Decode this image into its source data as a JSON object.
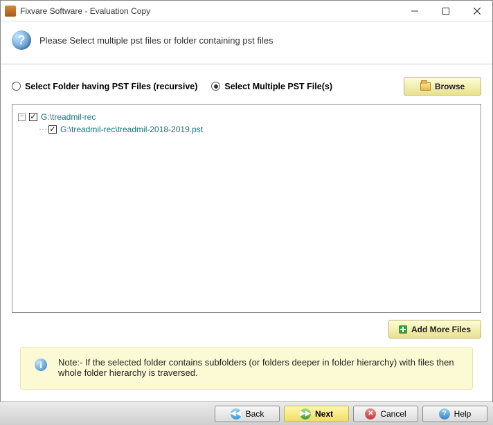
{
  "window": {
    "title": "Fixvare Software - Evaluation Copy"
  },
  "header": {
    "headline": "Please Select multiple pst files or folder containing pst files"
  },
  "options": {
    "folder_recursive": {
      "label": "Select Folder having PST Files (recursive)",
      "selected": false
    },
    "multiple_files": {
      "label": "Select Multiple PST File(s)",
      "selected": true
    },
    "browse_label": "Browse"
  },
  "tree": {
    "root": {
      "label": "G:\\treadmil-rec",
      "expanded": true,
      "checked": true
    },
    "children": [
      {
        "label": "G:\\treadmil-rec\\treadmil-2018-2019.pst",
        "checked": true
      }
    ]
  },
  "add_more_label": "Add More Files",
  "note": {
    "text": "Note:- If the selected folder contains subfolders (or folders deeper in folder hierarchy) with files then whole folder hierarchy is traversed."
  },
  "footer": {
    "back": "Back",
    "next": "Next",
    "cancel": "Cancel",
    "help": "Help"
  }
}
